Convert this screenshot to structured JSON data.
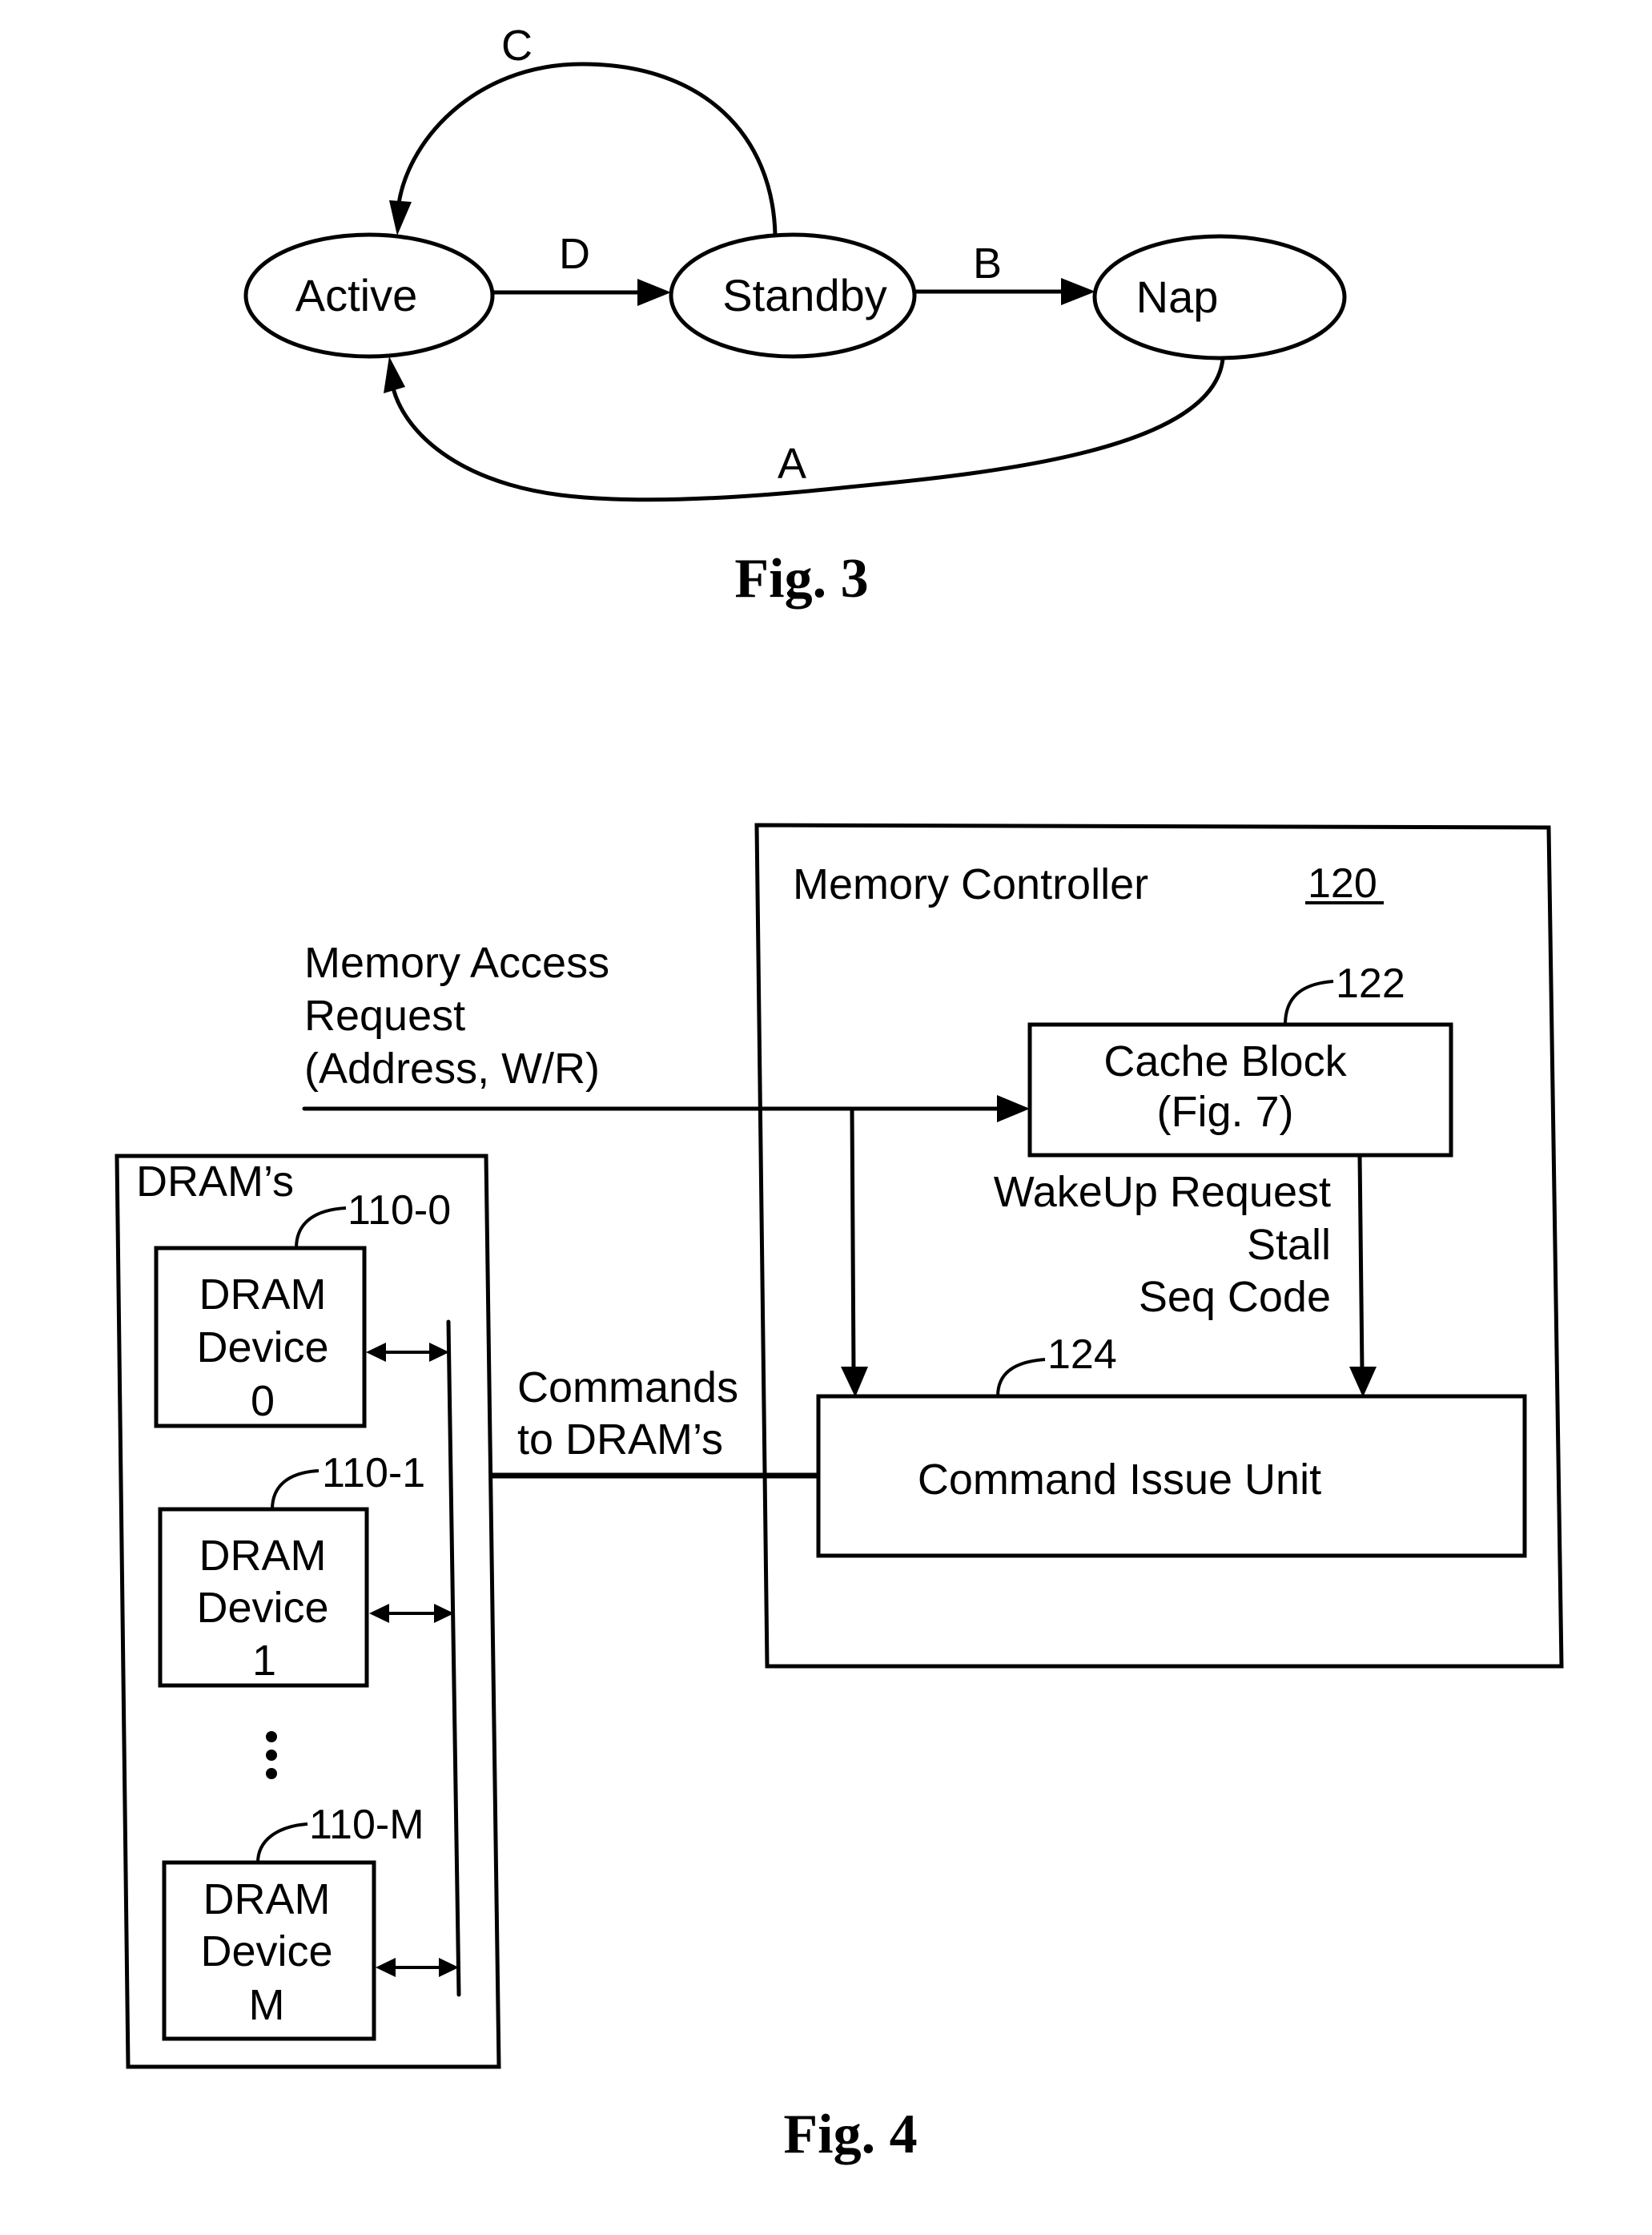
{
  "fig3": {
    "caption": "Fig. 3",
    "states": {
      "active": "Active",
      "standby": "Standby",
      "nap": "Nap"
    },
    "transitions": [
      {
        "label": "A",
        "from": "Nap",
        "to": "Active"
      },
      {
        "label": "B",
        "from": "Standby",
        "to": "Nap"
      },
      {
        "label": "C",
        "from": "Standby",
        "to": "Active"
      },
      {
        "label": "D",
        "from": "Active",
        "to": "Standby"
      }
    ]
  },
  "fig4": {
    "caption": "Fig. 4",
    "memory_controller": {
      "title": "Memory Controller",
      "ref": "120"
    },
    "input": {
      "lines": [
        "Memory Access",
        "Request",
        "(Address, W/R)"
      ]
    },
    "cache_block": {
      "ref": "122",
      "lines": [
        "Cache Block",
        "(Fig. 7)"
      ]
    },
    "signals": {
      "lines": [
        "WakeUp Request",
        "Stall",
        "Seq Code"
      ]
    },
    "command_issue_unit": {
      "ref": "124",
      "label": "Command Issue Unit"
    },
    "commands": {
      "lines": [
        "Commands",
        "to DRAM’s"
      ]
    },
    "drams": {
      "title": "DRAM’s",
      "ellipsis": "⋮",
      "devices": [
        {
          "ref": "110-0",
          "lines": [
            "DRAM",
            "Device",
            "0"
          ]
        },
        {
          "ref": "110-1",
          "lines": [
            "DRAM",
            "Device",
            "1"
          ]
        },
        {
          "ref": "110-M",
          "lines": [
            "DRAM",
            "Device",
            "M"
          ]
        }
      ]
    }
  }
}
